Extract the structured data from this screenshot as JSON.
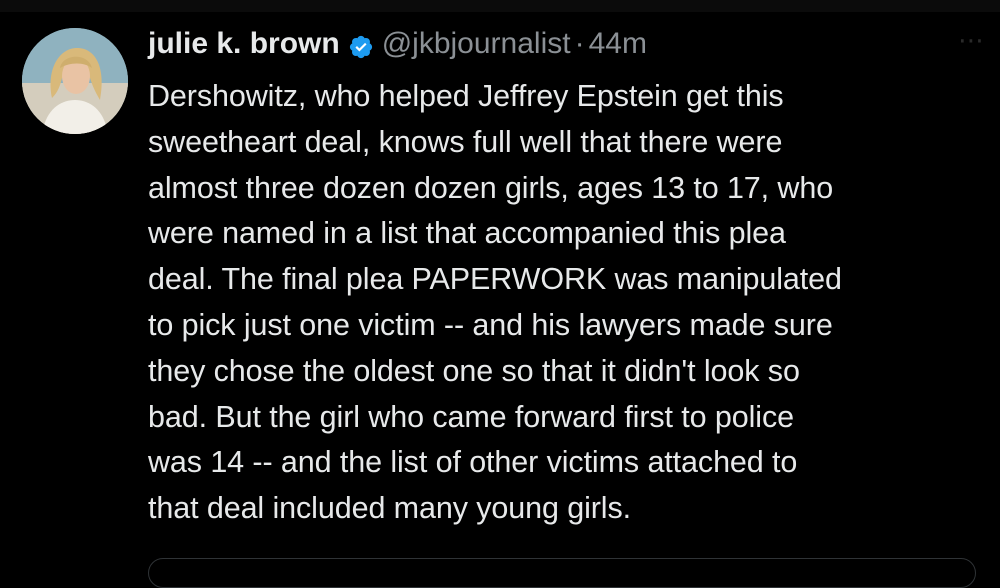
{
  "tweet": {
    "author_name": "julie k. brown",
    "handle": "@jkbjournalist",
    "separator": "·",
    "time": "44m",
    "text": "Dershowitz, who helped Jeffrey Epstein get this\nsweetheart deal, knows full well that there were\nalmost three dozen dozen girls, ages 13 to 17, who\nwere named in a list that accompanied this plea\ndeal. The final plea PAPERWORK was manipulated\nto pick just one victim -- and his lawyers made sure\nthey chose the oldest one so that it didn't look so\nbad. But the girl who came forward first to police\nwas 14 -- and the list of other victims attached to\nthat deal included many young girls."
  },
  "icons": {
    "verified": "verified-badge-icon",
    "more": "more-options-icon"
  },
  "colors": {
    "background": "#000000",
    "text_primary": "#e7e9ea",
    "text_secondary": "#8b9095",
    "verified_blue": "#1d9bf0"
  }
}
